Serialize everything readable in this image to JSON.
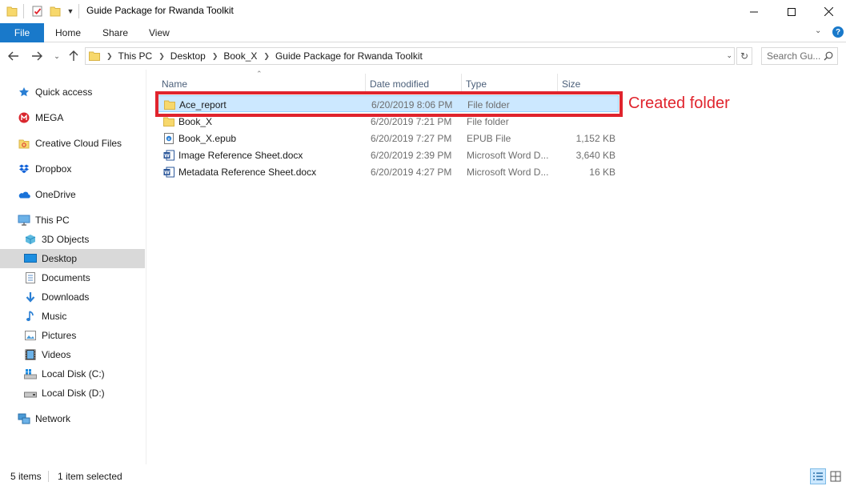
{
  "window": {
    "title": "Guide Package for Rwanda Toolkit"
  },
  "ribbon": {
    "tabs": [
      "File",
      "Home",
      "Share",
      "View"
    ]
  },
  "address_bar": {
    "crumbs": [
      "This PC",
      "Desktop",
      "Book_X",
      "Guide Package for Rwanda Toolkit"
    ],
    "search_placeholder": "Search Gu..."
  },
  "sidebar": {
    "items": [
      {
        "label": "Quick access",
        "icon": "star-icon",
        "level": 0
      },
      {
        "label": "MEGA",
        "icon": "mega-icon",
        "level": 0
      },
      {
        "label": "Creative Cloud Files",
        "icon": "creative-cloud-folder-icon",
        "level": 0
      },
      {
        "label": "Dropbox",
        "icon": "dropbox-icon",
        "level": 0
      },
      {
        "label": "OneDrive",
        "icon": "onedrive-cloud-icon",
        "level": 0
      },
      {
        "label": "This PC",
        "icon": "computer-icon",
        "level": 0
      },
      {
        "label": "3D Objects",
        "icon": "cube-icon",
        "level": 1
      },
      {
        "label": "Desktop",
        "icon": "desktop-icon",
        "level": 1,
        "selected": true
      },
      {
        "label": "Documents",
        "icon": "documents-icon",
        "level": 1
      },
      {
        "label": "Downloads",
        "icon": "download-arrow-icon",
        "level": 1
      },
      {
        "label": "Music",
        "icon": "music-note-icon",
        "level": 1
      },
      {
        "label": "Pictures",
        "icon": "pictures-icon",
        "level": 1
      },
      {
        "label": "Videos",
        "icon": "film-icon",
        "level": 1
      },
      {
        "label": "Local Disk (C:)",
        "icon": "windows-drive-icon",
        "level": 1
      },
      {
        "label": "Local Disk (D:)",
        "icon": "drive-icon",
        "level": 1
      },
      {
        "label": "Network",
        "icon": "network-icon",
        "level": 0
      }
    ]
  },
  "file_list": {
    "columns": [
      "Name",
      "Date modified",
      "Type",
      "Size"
    ],
    "rows": [
      {
        "name": "Ace_report",
        "date": "6/20/2019 8:06 PM",
        "type": "File folder",
        "size": "",
        "icon": "folder-icon",
        "selected": true
      },
      {
        "name": "Book_X",
        "date": "6/20/2019 7:21 PM",
        "type": "File folder",
        "size": "",
        "icon": "folder-icon"
      },
      {
        "name": "Book_X.epub",
        "date": "6/20/2019 7:27 PM",
        "type": "EPUB File",
        "size": "1,152 KB",
        "icon": "epub-file-icon"
      },
      {
        "name": "Image Reference Sheet.docx",
        "date": "6/20/2019 2:39 PM",
        "type": "Microsoft Word D...",
        "size": "3,640 KB",
        "icon": "word-doc-icon"
      },
      {
        "name": "Metadata Reference Sheet.docx",
        "date": "6/20/2019 4:27 PM",
        "type": "Microsoft Word D...",
        "size": "16 KB",
        "icon": "word-doc-icon"
      }
    ]
  },
  "annotation": {
    "label": "Created folder",
    "color": "#e0242d"
  },
  "status_bar": {
    "item_count": "5 items",
    "selection": "1 item selected"
  },
  "colors": {
    "accent": "#1979ca",
    "selection": "#cce8ff",
    "folder": "#f7d86c"
  }
}
